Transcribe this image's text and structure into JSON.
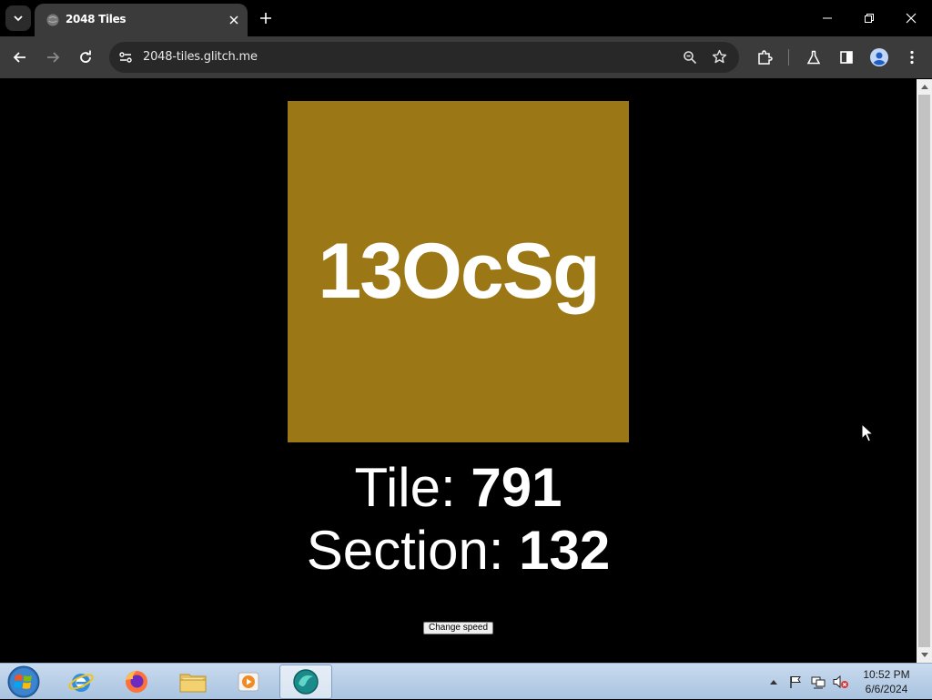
{
  "browser": {
    "tab_title": "2048 Tiles",
    "url": "2048-tiles.glitch.me"
  },
  "page": {
    "tile_text": "13OcSg",
    "tile_color": "#9b7815",
    "tile_label": "Tile: ",
    "tile_value": "791",
    "section_label": "Section: ",
    "section_value": "132",
    "change_speed_label": "Change speed"
  },
  "taskbar": {
    "apps": [
      "internet-explorer",
      "firefox",
      "file-explorer",
      "media-player",
      "active-app"
    ],
    "clock_time": "10:52 PM",
    "clock_date": "6/6/2024"
  }
}
